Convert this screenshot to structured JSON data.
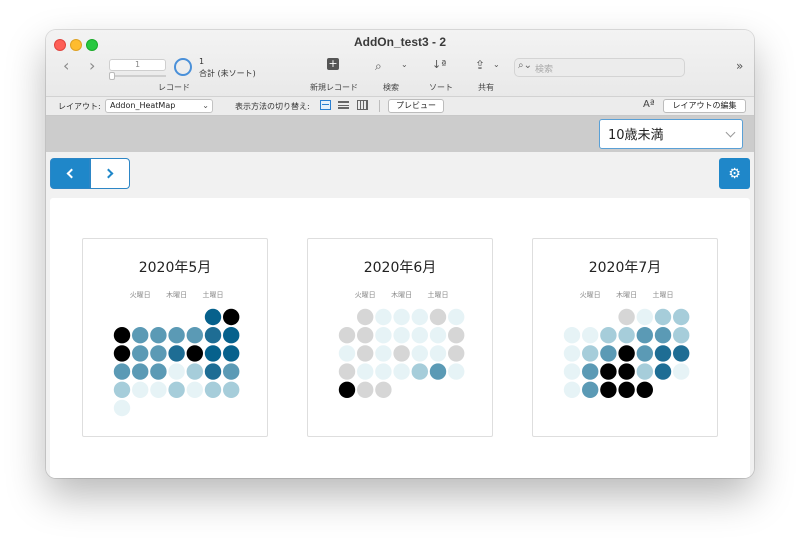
{
  "window": {
    "title": "AddOn_test3 - 2"
  },
  "toolbar": {
    "record_field_value": "1",
    "record_count": "1",
    "record_total": "合計 (未ソート)",
    "records_label": "レコード",
    "new_record_label": "新規レコード",
    "find_label": "検索",
    "sort_label": "ソート",
    "share_label": "共有",
    "search_placeholder": "検索"
  },
  "layout_bar": {
    "layout_label": "レイアウト:",
    "layout_value": "Addon_HeatMap",
    "view_as_label": "表示方法の切り替え:",
    "preview_label": "プレビュー",
    "edit_layout_label": "レイアウトの編集",
    "font_size_icon": "Aª"
  },
  "filter": {
    "age_value": "10歳未満"
  },
  "calendars": [
    {
      "title": "2020年5月",
      "weekday_labels": [
        "火曜日",
        "木曜日",
        "土曜日"
      ],
      "first_weekday": 5,
      "levels": [
        5,
        6,
        6,
        3,
        3,
        3,
        3,
        4,
        5,
        6,
        3,
        3,
        4,
        6,
        5,
        5,
        3,
        3,
        3,
        1,
        2,
        4,
        3,
        2,
        1,
        1,
        2,
        1,
        2,
        2,
        1
      ]
    },
    {
      "title": "2020年6月",
      "weekday_labels": [
        "火曜日",
        "木曜日",
        "土曜日"
      ],
      "first_weekday": 1,
      "levels": [
        0,
        1,
        1,
        1,
        0,
        1,
        0,
        0,
        1,
        1,
        1,
        1,
        0,
        1,
        0,
        1,
        0,
        1,
        1,
        0,
        0,
        1,
        1,
        1,
        2,
        3,
        1,
        6,
        0,
        0
      ],
      "extra": {
        "0": 0
      }
    },
    {
      "title": "2020年7月",
      "weekday_labels": [
        "火曜日",
        "木曜日",
        "土曜日"
      ],
      "first_weekday": 3,
      "levels": [
        0,
        1,
        2,
        2,
        1,
        1,
        2,
        2,
        3,
        3,
        2,
        1,
        2,
        3,
        6,
        3,
        4,
        4,
        1,
        3,
        6,
        6,
        2,
        4,
        1,
        1,
        3,
        6,
        6,
        6
      ]
    }
  ],
  "colors": {
    "accent": "#1f87c9",
    "level0": "#d6d6d6",
    "level1": "#e6f3f6",
    "level2": "#a6cdda",
    "level3": "#5b9ab5",
    "level4": "#1e6d94",
    "level5": "#06618c",
    "level6": "#000000"
  }
}
